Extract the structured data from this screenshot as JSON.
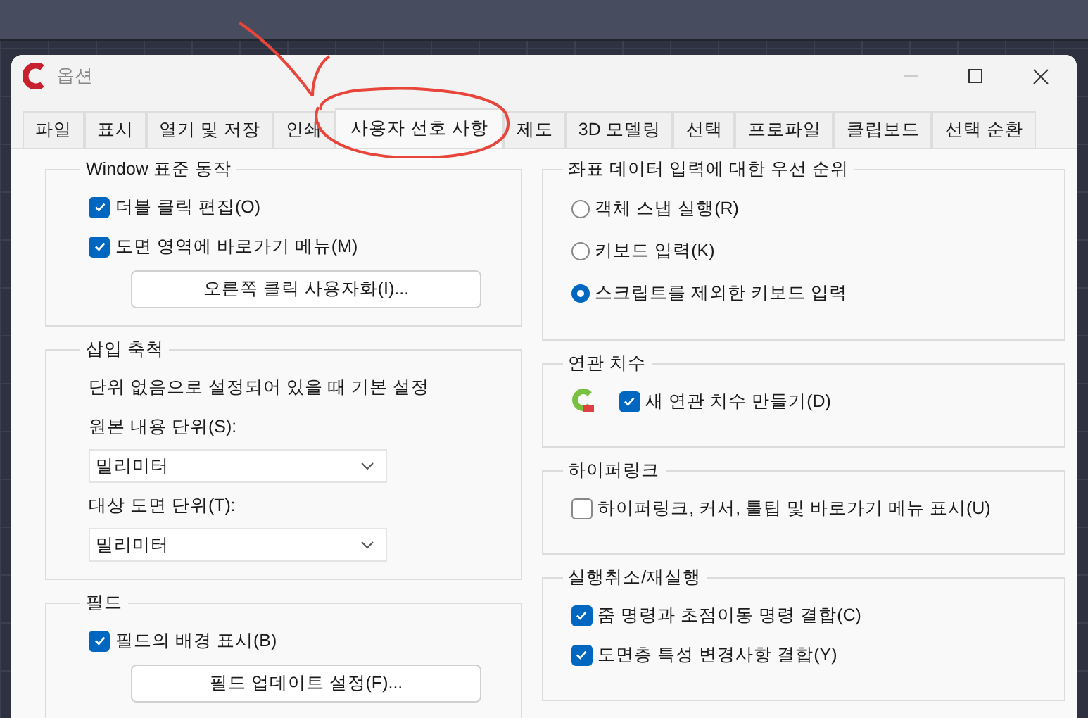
{
  "window": {
    "title": "옵션"
  },
  "tabs": [
    {
      "label": "파일",
      "selected": false
    },
    {
      "label": "표시",
      "selected": false
    },
    {
      "label": "열기 및 저장",
      "selected": false
    },
    {
      "label": "인쇄",
      "selected": false
    },
    {
      "label": "사용자 선호 사항",
      "selected": true
    },
    {
      "label": "제도",
      "selected": false
    },
    {
      "label": "3D 모델링",
      "selected": false
    },
    {
      "label": "선택",
      "selected": false
    },
    {
      "label": "프로파일",
      "selected": false
    },
    {
      "label": "클립보드",
      "selected": false
    },
    {
      "label": "선택 순환",
      "selected": false
    }
  ],
  "left_groups": [
    {
      "title": "Window 표준 동작",
      "items": [
        {
          "kind": "checkbox",
          "label": "더블 클릭 편집(O)",
          "checked": true
        },
        {
          "kind": "checkbox",
          "label": "도면 영역에 바로가기 메뉴(M)",
          "checked": true
        },
        {
          "kind": "button",
          "label": "오른쪽 클릭 사용자화(I)..."
        }
      ]
    },
    {
      "title": "삽입 축척",
      "items": [
        {
          "kind": "text",
          "label": "단위 없음으로 설정되어 있을 때 기본 설정"
        },
        {
          "kind": "text",
          "label": "원본 내용 단위(S):"
        },
        {
          "kind": "dropdown",
          "value": "밀리미터"
        },
        {
          "kind": "text",
          "label": "대상 도면 단위(T):"
        },
        {
          "kind": "dropdown",
          "value": "밀리미터"
        }
      ]
    },
    {
      "title": "필드",
      "items": [
        {
          "kind": "checkbox",
          "label": "필드의 배경 표시(B)",
          "checked": true
        },
        {
          "kind": "button",
          "label": "필드 업데이트 설정(F)..."
        }
      ]
    }
  ],
  "right_groups": [
    {
      "title": "좌표 데이터 입력에 대한 우선 순위",
      "items": [
        {
          "kind": "radio",
          "label": "객체 스냅 실행(R)",
          "selected": false
        },
        {
          "kind": "radio",
          "label": "키보드 입력(K)",
          "selected": false
        },
        {
          "kind": "radio",
          "label": "스크립트를 제외한 키보드 입력",
          "selected": true
        }
      ]
    },
    {
      "title": "연관 치수",
      "items": [
        {
          "kind": "icon_checkbox",
          "label": "새 연관 치수 만들기(D)",
          "checked": true
        }
      ]
    },
    {
      "title": "하이퍼링크",
      "items": [
        {
          "kind": "checkbox",
          "label": "하이퍼링크, 커서, 툴팁 및 바로가기 메뉴 표시(U)",
          "checked": false
        }
      ]
    },
    {
      "title": "실행취소/재실행",
      "items": [
        {
          "kind": "checkbox",
          "label": "줌 명령과 초점이동 명령 결합(C)",
          "checked": true
        },
        {
          "kind": "checkbox",
          "label": "도면층 특성 변경사항 결합(Y)",
          "checked": true
        }
      ]
    }
  ]
}
